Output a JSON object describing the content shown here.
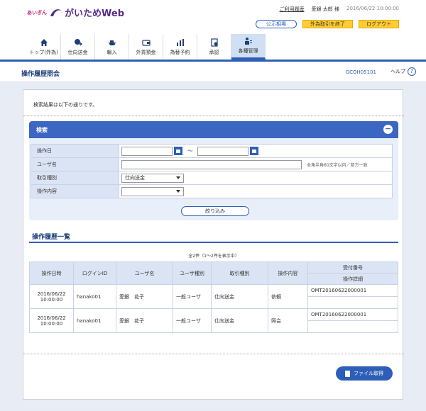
{
  "header": {
    "logo_small": "あいぎん",
    "logo_main": "がいためWeb",
    "history_link": "ご利用履歴",
    "user_name": "愛銀 太郎 様",
    "datetime": "2016/06/22 10:00:00",
    "rate_button": "公示相場",
    "end_fx_button": "外為取引を終了",
    "logout_button": "ログアウト"
  },
  "nav": {
    "items": [
      "トップ(外為)",
      "仕向送金",
      "輸入",
      "外貨預金",
      "為替予約",
      "承認",
      "各種管理"
    ]
  },
  "page": {
    "title": "操作履歴照会",
    "screen_id": "GCOH05101",
    "help": "ヘルプ",
    "help_icon_glyph": "?",
    "result_msg": "検索結果は以下の通りです。"
  },
  "search": {
    "title": "検索",
    "collapse_glyph": "−",
    "labels": {
      "date": "操作日",
      "user": "ユーザ名",
      "type": "取引種別",
      "content": "操作内容"
    },
    "tilde": "～",
    "user_hint": "全角半角60文字以内／前方一致",
    "type_value": "仕向送金",
    "content_value": "",
    "filter_button": "絞り込み"
  },
  "list": {
    "title": "操作履歴一覧",
    "count": "全2件（1～2件を表示中）",
    "headers": {
      "datetime": "操作日時",
      "login_id": "ログインID",
      "user_name": "ユーザ名",
      "user_type": "ユーザ種別",
      "trans_type": "取引種別",
      "content": "操作内容",
      "receipt_no": "受付番号",
      "detail": "操作詳細"
    },
    "rows": [
      {
        "date": "2016/06/22",
        "time": "10:00:00",
        "login_id": "hanako01",
        "user_name": "愛銀　花子",
        "user_type": "一般ユーザ",
        "trans_type": "仕向送金",
        "content": "依頼",
        "receipt_no": "OMT20160622000001",
        "detail": ""
      },
      {
        "date": "2016/06/22",
        "time": "10:00:00",
        "login_id": "hanako01",
        "user_name": "愛銀　花子",
        "user_type": "一般ユーザ",
        "trans_type": "仕向送金",
        "content": "照会",
        "receipt_no": "OMT20160622000001",
        "detail": ""
      }
    ]
  },
  "footer": {
    "file_button": "ファイル取得"
  },
  "colors": {
    "primary": "#2d5fb8",
    "header_blue": "#3b66c2",
    "logout_yellow": "#ffcc33"
  }
}
